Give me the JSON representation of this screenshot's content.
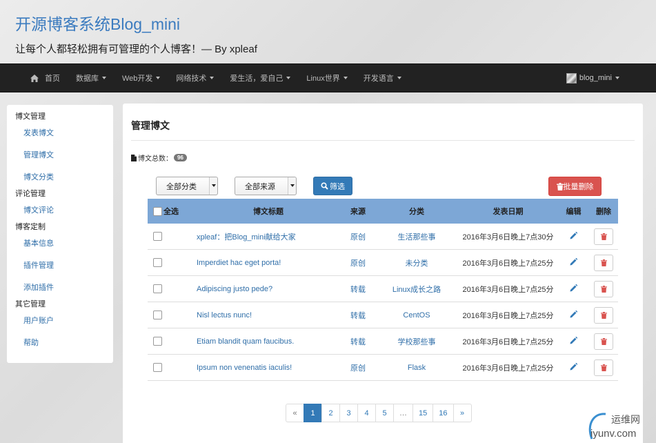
{
  "header": {
    "title": "开源博客系统Blog_mini",
    "subtitle": "让每个人都轻松拥有可管理的个人博客！— By xpleaf"
  },
  "navbar": {
    "home": "首页",
    "items": [
      "数据库",
      "Web开发",
      "网络技术",
      "爱生活，爱自己",
      "Linux世界",
      "开发语言"
    ],
    "user": "blog_mini"
  },
  "sidebar": {
    "groups": [
      {
        "title": "博文管理",
        "links": [
          "发表博文",
          "管理博文",
          "博文分类"
        ]
      },
      {
        "title": "评论管理",
        "links": [
          "博文评论"
        ]
      },
      {
        "title": "博客定制",
        "links": [
          "基本信息",
          "插件管理",
          "添加插件"
        ]
      },
      {
        "title": "其它管理",
        "links": [
          "用户账户",
          "帮助"
        ]
      }
    ]
  },
  "main": {
    "title": "管理博文",
    "total_label": "博文总数：",
    "total_count": "96",
    "filter_category": "全部分类",
    "filter_source": "全部来源",
    "filter_button": "筛选",
    "batch_delete_button": "批量删除",
    "columns": {
      "select_all": "全选",
      "title": "博文标题",
      "source": "来源",
      "category": "分类",
      "date": "发表日期",
      "edit": "编辑",
      "delete": "删除"
    },
    "rows": [
      {
        "title": "xpleaf：把Blog_mini献给大家",
        "source": "原创",
        "category": "生活那些事",
        "date": "2016年3月6日晚上7点30分"
      },
      {
        "title": "Imperdiet hac eget porta!",
        "source": "原创",
        "category": "未分类",
        "date": "2016年3月6日晚上7点25分"
      },
      {
        "title": "Adipiscing justo pede?",
        "source": "转载",
        "category": "Linux成长之路",
        "date": "2016年3月6日晚上7点25分"
      },
      {
        "title": "Nisl lectus nunc!",
        "source": "转载",
        "category": "CentOS",
        "date": "2016年3月6日晚上7点25分"
      },
      {
        "title": "Etiam blandit quam faucibus.",
        "source": "转载",
        "category": "学校那些事",
        "date": "2016年3月6日晚上7点25分"
      },
      {
        "title": "Ipsum non venenatis iaculis!",
        "source": "原创",
        "category": "Flask",
        "date": "2016年3月6日晚上7点25分"
      }
    ],
    "pagination": [
      "«",
      "1",
      "2",
      "3",
      "4",
      "5",
      "…",
      "15",
      "16",
      "»"
    ],
    "current_page": "1"
  },
  "watermark": {
    "top": "运维网",
    "bottom": "iyunv.com"
  },
  "colors": {
    "accent": "#337ab7",
    "danger": "#d9534f",
    "navbar": "#222222",
    "table_header": "#7da7d6"
  }
}
